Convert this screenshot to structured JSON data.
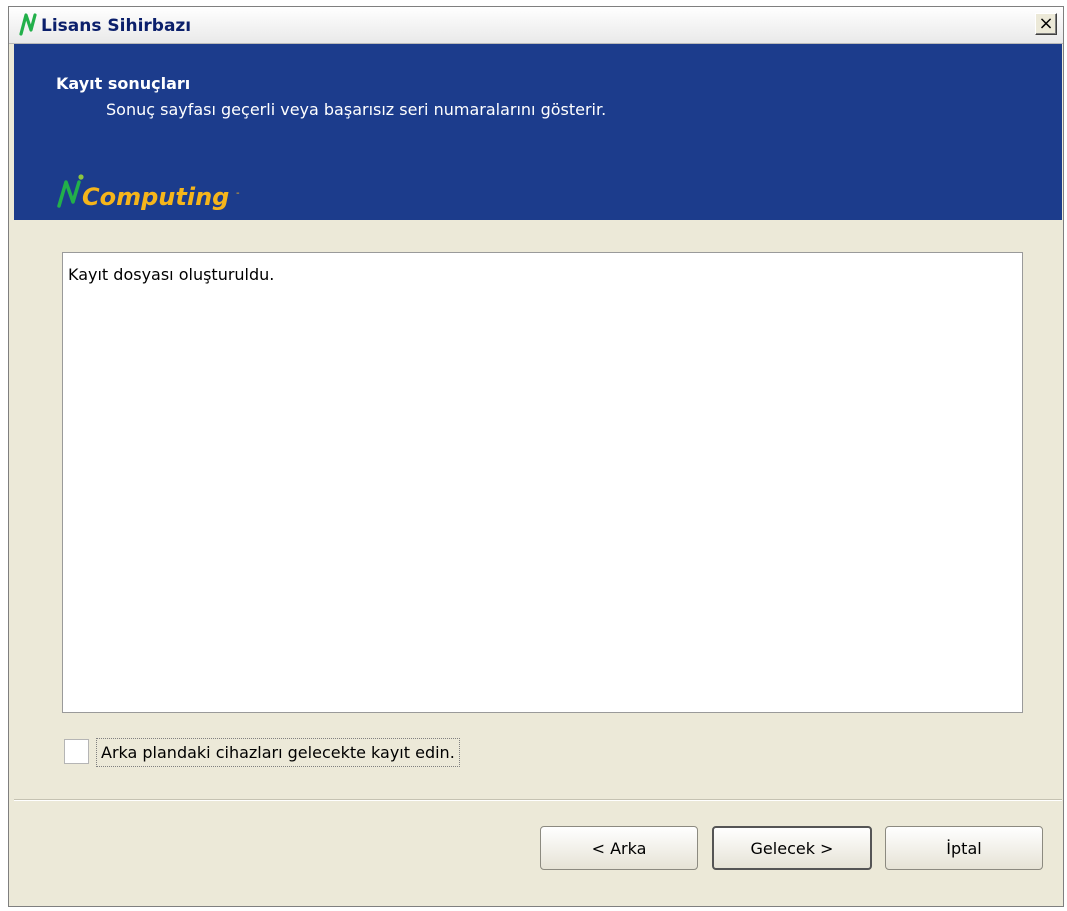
{
  "window": {
    "title": "Lisans Sihirbazı",
    "close_label": "×"
  },
  "header": {
    "title": "Kayıt sonuçları",
    "subtitle": "Sonuç sayfası geçerli veya başarısız seri numaralarını gösterir.",
    "brand": "Computing",
    "brand_colors": {
      "n": "#22b04a",
      "dot": "#8cc63f",
      "text": "#f5b51b"
    }
  },
  "results": {
    "text": "Kayıt dosyası oluşturuldu."
  },
  "checkbox": {
    "label": "Arka plandaki cihazları gelecekte kayıt edin.",
    "checked": false
  },
  "buttons": {
    "back": "< Arka",
    "next": "Gelecek >",
    "cancel": "İptal"
  },
  "colors": {
    "header_bg": "#1c3c8c",
    "dialog_bg": "#ece9d8"
  }
}
